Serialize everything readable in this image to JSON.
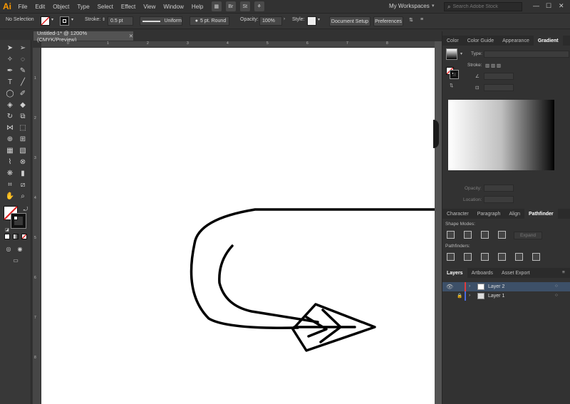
{
  "menubar": {
    "logo": "Ai",
    "items": [
      "File",
      "Edit",
      "Object",
      "Type",
      "Select",
      "Effect",
      "View",
      "Window",
      "Help"
    ],
    "bridge_icon": "Br",
    "stock_icon": "St",
    "workspace_label": "My Workspaces",
    "search_placeholder": "Search Adobe Stock"
  },
  "controlbar": {
    "selection_label": "No Selection",
    "stroke_label": "Stroke:",
    "stroke_value": "0.5 pt",
    "profile_label": "Uniform",
    "brush_label": "5 pt. Round",
    "opacity_label": "Opacity:",
    "opacity_value": "100%",
    "style_label": "Style:",
    "document_setup_label": "Document Setup",
    "preferences_label": "Preferences"
  },
  "document": {
    "tab_title": "Untitled-1* @ 1200% (CMYK/Preview)"
  },
  "ruler": {
    "h_ticks": [
      "0",
      "1",
      "2",
      "3",
      "4",
      "5",
      "6",
      "7",
      "8"
    ],
    "v_ticks": [
      "1",
      "2",
      "3",
      "4",
      "5",
      "6",
      "7",
      "8"
    ]
  },
  "gradient_panel": {
    "tabs": [
      "Color",
      "Color Guide",
      "Appearance",
      "Gradient"
    ],
    "active_tab": "Gradient",
    "type_label": "Type:",
    "stroke_label": "Stroke:",
    "opacity_label": "Opacity:",
    "location_label": "Location:"
  },
  "pathfinder_panel": {
    "tabs": [
      "Character",
      "Paragraph",
      "Align",
      "Pathfinder"
    ],
    "active_tab": "Pathfinder",
    "shape_modes_label": "Shape Modes:",
    "expand_label": "Expand",
    "pathfinders_label": "Pathfinders:"
  },
  "layers_panel": {
    "tabs": [
      "Layers",
      "Artboards",
      "Asset Export"
    ],
    "active_tab": "Layers",
    "layers": [
      {
        "name": "Layer 2",
        "color": "#e03c3c",
        "selected": true
      },
      {
        "name": "Layer 1",
        "color": "#4a6be0",
        "selected": false
      }
    ]
  },
  "colors": {
    "ai_orange": "#ff9a00",
    "selected_row": "#3d5068",
    "canvas": "#ffffff"
  }
}
